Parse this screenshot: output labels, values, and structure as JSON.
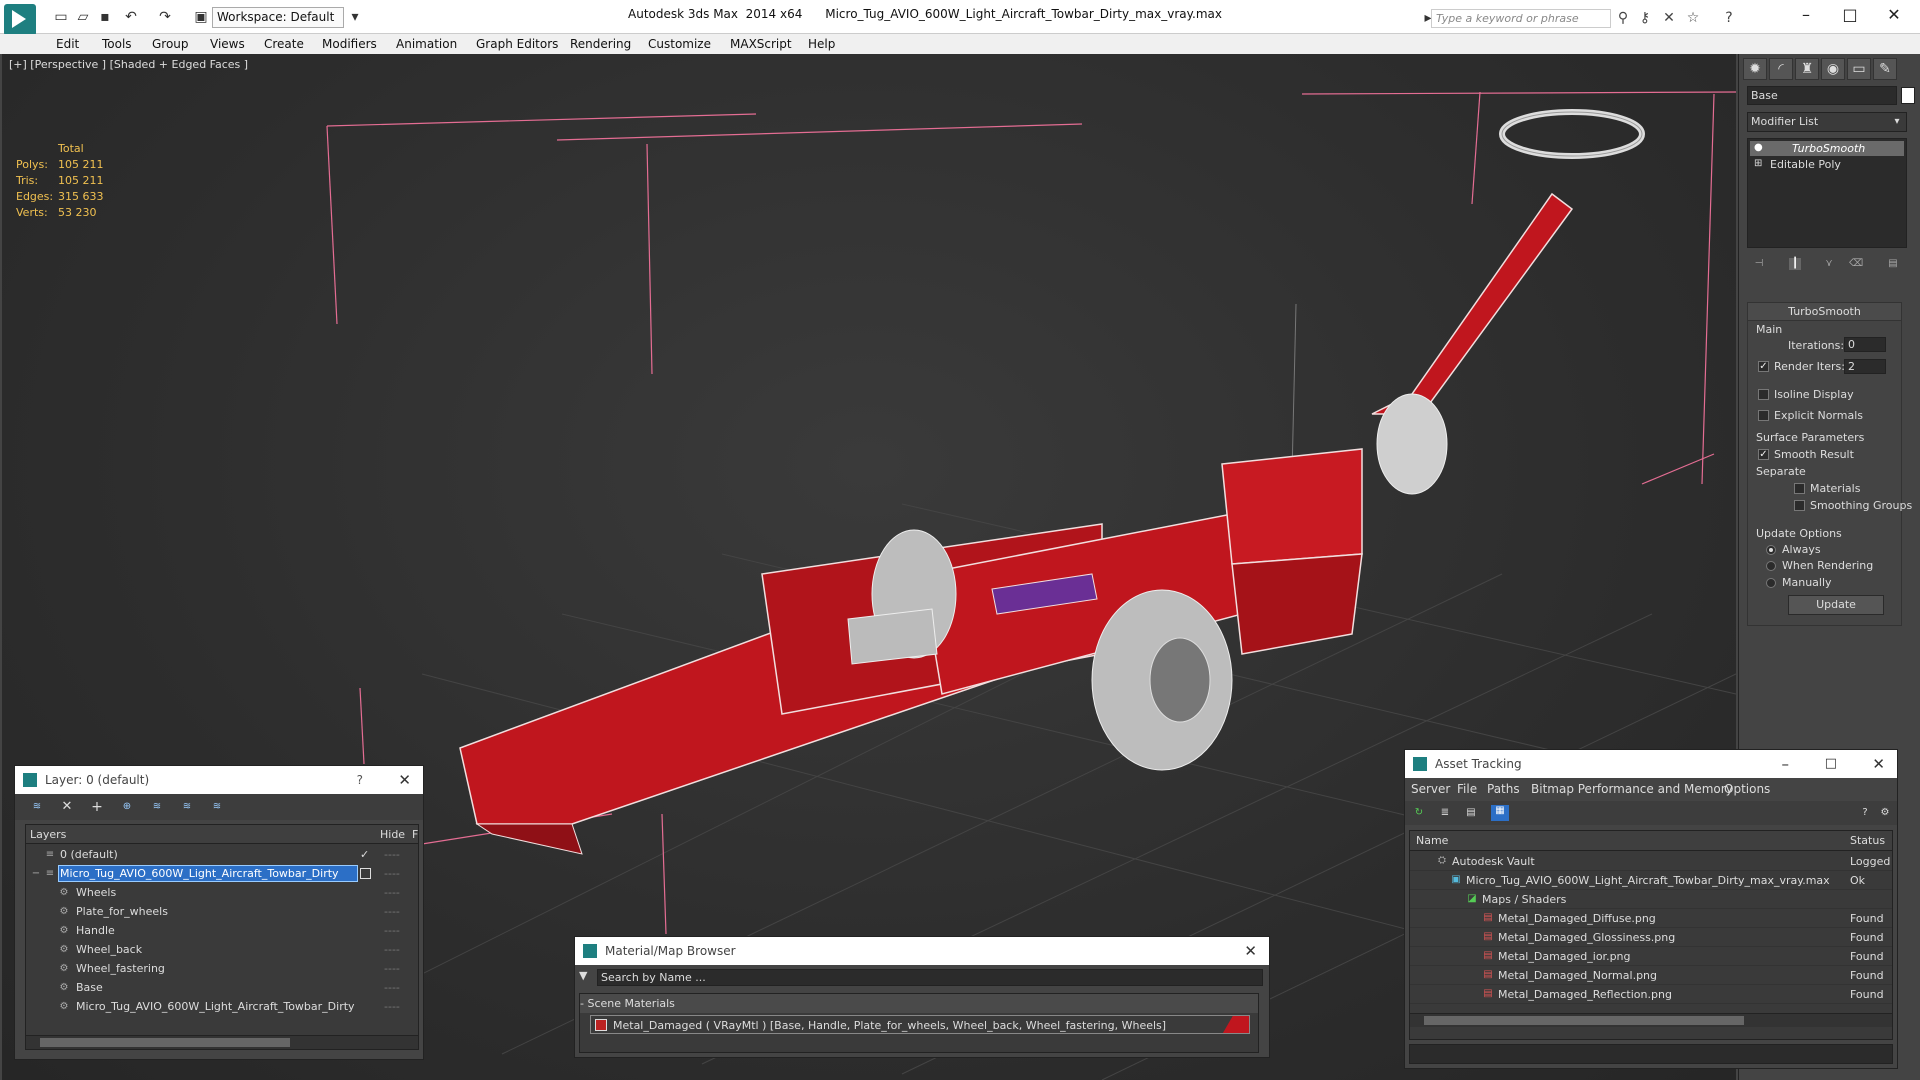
{
  "titlebar": {
    "workspace": "Workspace: Default",
    "app_title": "Autodesk 3ds Max  2014 x64      Micro_Tug_AVIO_600W_Light_Aircraft_Towbar_Dirty_max_vray.max",
    "search_placeholder": "Type a keyword or phrase"
  },
  "menu": [
    "Edit",
    "Tools",
    "Group",
    "Views",
    "Create",
    "Modifiers",
    "Animation",
    "Graph Editors",
    "Rendering",
    "Customize",
    "MAXScript",
    "Help"
  ],
  "viewport": {
    "label": "[+] [Perspective ] [Shaded + Edged Faces ]",
    "stats": {
      "header": "Total",
      "rows": [
        {
          "k": "Polys:",
          "v": "105 211"
        },
        {
          "k": "Tris:",
          "v": "105 211"
        },
        {
          "k": "Edges:",
          "v": "315 633"
        },
        {
          "k": "Verts:",
          "v": "53 230"
        }
      ]
    }
  },
  "command_panel": {
    "object_name": "Base",
    "modifier_list": "Modifier List",
    "stack": [
      "TurboSmooth",
      "Editable Poly"
    ],
    "turbosmooth": {
      "title": "TurboSmooth",
      "main": "Main",
      "iterations_label": "Iterations:",
      "iterations": "0",
      "render_iters_label": "Render Iters:",
      "render_iters": "2",
      "isoline": "Isoline Display",
      "explicit_normals": "Explicit Normals",
      "surface_params": "Surface Parameters",
      "smooth_result": "Smooth Result",
      "separate": "Separate",
      "materials": "Materials",
      "smoothing_groups": "Smoothing Groups",
      "update_options": "Update Options",
      "always": "Always",
      "when_rendering": "When Rendering",
      "manually": "Manually",
      "update_btn": "Update"
    }
  },
  "layers": {
    "title": "Layer: 0 (default)",
    "col_layers": "Layers",
    "col_hide": "Hide",
    "col_f": "F",
    "rows": [
      "0 (default)",
      "Micro_Tug_AVIO_600W_Light_Aircraft_Towbar_Dirty",
      "Wheels",
      "Plate_for_wheels",
      "Handle",
      "Wheel_back",
      "Wheel_fastering",
      "Base",
      "Micro_Tug_AVIO_600W_Light_Aircraft_Towbar_Dirty"
    ]
  },
  "material_browser": {
    "title": "Material/Map Browser",
    "search_placeholder": "Search by Name ...",
    "section": "- Scene Materials",
    "material": "Metal_Damaged  ( VRayMtl ) [Base, Handle, Plate_for_wheels, Wheel_back, Wheel_fastering, Wheels]"
  },
  "asset_tracking": {
    "title": "Asset Tracking",
    "menu": [
      "Server",
      "File",
      "Paths",
      "Bitmap Performance and Memory",
      "Options"
    ],
    "col_name": "Name",
    "col_status": "Status",
    "rows": [
      {
        "name": "Autodesk Vault",
        "status": "Logged O"
      },
      {
        "name": "Micro_Tug_AVIO_600W_Light_Aircraft_Towbar_Dirty_max_vray.max",
        "status": "Ok"
      },
      {
        "name": "Maps / Shaders",
        "status": ""
      },
      {
        "name": "Metal_Damaged_Diffuse.png",
        "status": "Found"
      },
      {
        "name": "Metal_Damaged_Glossiness.png",
        "status": "Found"
      },
      {
        "name": "Metal_Damaged_ior.png",
        "status": "Found"
      },
      {
        "name": "Metal_Damaged_Normal.png",
        "status": "Found"
      },
      {
        "name": "Metal_Damaged_Reflection.png",
        "status": "Found"
      }
    ]
  }
}
